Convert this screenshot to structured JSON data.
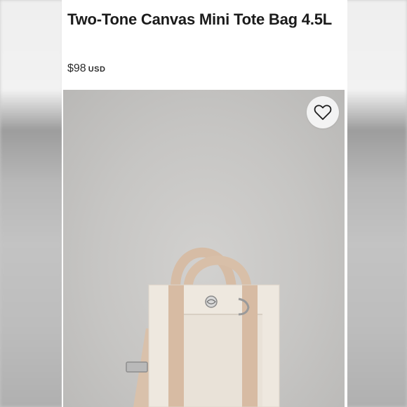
{
  "product": {
    "title": "Two-Tone Canvas Mini Tote Bag 4.5L",
    "price": "$98",
    "currency": "USD"
  },
  "icons": {
    "favorite": "heart-outline-icon"
  },
  "colors": {
    "canvas_body": "#efe9e1",
    "accent_tan": "#d7bba3",
    "photo_bg": "#c6c5c3"
  }
}
